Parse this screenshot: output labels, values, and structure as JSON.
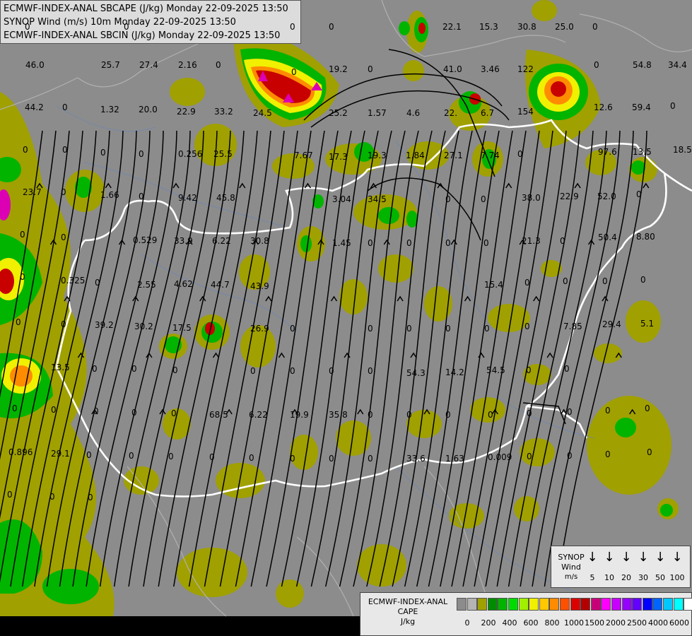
{
  "header": {
    "line1": "ECMWF-INDEX-ANAL SBCAPE (J/kg) Monday 22-09-2025 13:50",
    "line2": "SYNOP Wind (m/s) 10m Monday 22-09-2025 13:50",
    "line3": "ECMWF-INDEX-ANAL SBCIN (J/kg) Monday 22-09-2025 13:50"
  },
  "colors": {
    "background": "#8c8c8c",
    "cape_low": "#a0a000",
    "cape_green": "#00b400",
    "cape_yellow": "#f0f000",
    "cape_orange": "#ff8c00",
    "cape_red": "#c80000",
    "cape_magenta": "#dc00b4",
    "border": "#ffffff",
    "streamline": "#000000"
  },
  "map_labels": [
    "0",
    "0",
    "22.1",
    "15.3",
    "30.8",
    "25.0",
    "0",
    "0",
    "0",
    "46.0",
    "25.7",
    "27.4",
    "2.16",
    "0",
    "0",
    "19.2",
    "0",
    "41.0",
    "3.46",
    "122",
    "0",
    "54.8",
    "34.4",
    "44.2",
    "0",
    "1.32",
    "20.0",
    "22.9",
    "33.2",
    "24.5",
    "25.2",
    "1.57",
    "4.6",
    "22.",
    "6.7",
    "154",
    "12.6",
    "59.4",
    "0",
    "0",
    "0",
    "0",
    "0",
    "0.256",
    "25.5",
    "7.67",
    "17.3",
    "19.3",
    "1.84",
    "27.1",
    "7.74",
    "0",
    "97.6",
    "13.5",
    "18.5",
    "23.7",
    "0",
    "1.66",
    "0",
    "9.42",
    "45.8",
    "3.04",
    "34.5",
    "0",
    "0",
    "38.0",
    "22.9",
    "52.0",
    "0",
    "0",
    "0",
    "0.529",
    "33.9",
    "6.22",
    "30.8",
    "1.45",
    "0",
    "0",
    "0",
    "0",
    "21.3",
    "0",
    "50.4",
    "8.80",
    "0",
    "0.325",
    "0",
    "2.55",
    "4.62",
    "44.7",
    "43.9",
    "15.4",
    "0",
    "0",
    "0",
    "0",
    "0",
    "0",
    "39.2",
    "30.2",
    "17.5",
    "26.9",
    "0",
    "0",
    "0",
    "0",
    "0",
    "0",
    "7.85",
    "29.4",
    "5.1",
    "13.5",
    "0",
    "0",
    "0",
    "0",
    "0",
    "0",
    "0",
    "54.3",
    "14.2",
    "54.5",
    "0",
    "0",
    "0",
    "0",
    "0",
    "0",
    "0",
    "68.5",
    "6.22",
    "19.9",
    "35.8",
    "0",
    "0",
    "0",
    "0",
    "0",
    "0",
    "0",
    "0",
    "0.896",
    "29.1",
    "0",
    "0",
    "0",
    "0",
    "0",
    "0",
    "0",
    "0",
    "33.6",
    "1.63",
    "0.009",
    "0",
    "0",
    "0",
    "0",
    "0",
    "0",
    "0"
  ],
  "wind_legend": {
    "title_line1": "SYNOP",
    "title_line2": "Wind",
    "title_line3": "m/s",
    "speeds": [
      "5",
      "10",
      "20",
      "30",
      "50",
      "100"
    ],
    "arrow_glyph": "↓"
  },
  "cape_legend": {
    "title_line1": "ECMWF-INDEX-ANAL",
    "title_line2": "CAPE",
    "title_line3": "J/kg",
    "swatch_colors": [
      "#8c8c8c",
      "#b4b4b4",
      "#a0a000",
      "#008c00",
      "#00b400",
      "#00dc00",
      "#a0f000",
      "#f0f000",
      "#ffc800",
      "#ff8c00",
      "#ff5000",
      "#dc0000",
      "#b40000",
      "#c80078",
      "#ff00ff",
      "#c800ff",
      "#9600ff",
      "#6400ff",
      "#0000ff",
      "#0064ff",
      "#00c8ff",
      "#00ffff",
      "#ffffff"
    ],
    "ticks": [
      "0",
      "200",
      "400",
      "600",
      "800",
      "1000",
      "1500",
      "2000",
      "2500",
      "4000",
      "6000"
    ]
  }
}
